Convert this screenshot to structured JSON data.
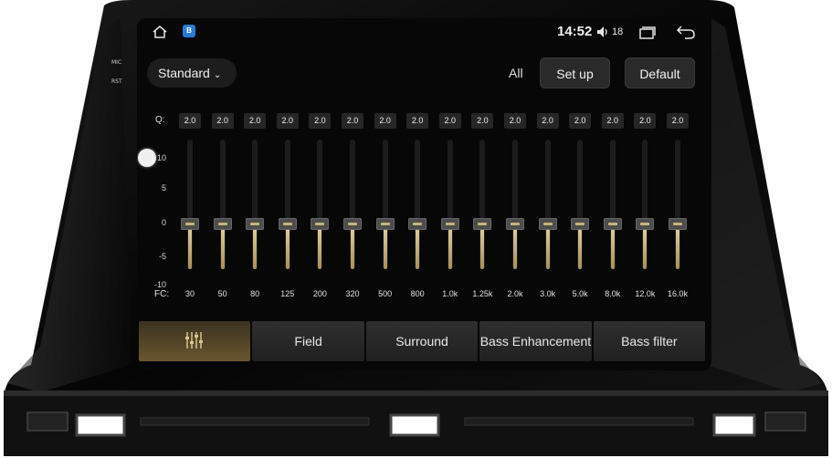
{
  "hardware": {
    "mic_label": "MIC",
    "rst_label": "RST"
  },
  "statusbar": {
    "clock": "14:52",
    "volume": "18",
    "icons": [
      "home-icon",
      "app-icon",
      "volume-icon",
      "recent-apps-icon",
      "back-icon"
    ]
  },
  "toolbar": {
    "preset": "Standard",
    "all_label": "All",
    "setup_label": "Set up",
    "default_label": "Default"
  },
  "eq": {
    "q_label": "Q:",
    "fc_label": "FC:",
    "y_ticks": [
      "10",
      "5",
      "0",
      "-5",
      "-10"
    ],
    "bands": [
      {
        "q": "2.0",
        "fc": "30",
        "gain": 0
      },
      {
        "q": "2.0",
        "fc": "50",
        "gain": 0
      },
      {
        "q": "2.0",
        "fc": "80",
        "gain": 0
      },
      {
        "q": "2.0",
        "fc": "125",
        "gain": 0
      },
      {
        "q": "2.0",
        "fc": "200",
        "gain": 0
      },
      {
        "q": "2.0",
        "fc": "320",
        "gain": 0
      },
      {
        "q": "2.0",
        "fc": "500",
        "gain": 0
      },
      {
        "q": "2.0",
        "fc": "800",
        "gain": 0
      },
      {
        "q": "2.0",
        "fc": "1.0k",
        "gain": 0
      },
      {
        "q": "2.0",
        "fc": "1.25k",
        "gain": 0
      },
      {
        "q": "2.0",
        "fc": "2.0k",
        "gain": 0
      },
      {
        "q": "2.0",
        "fc": "3.0k",
        "gain": 0
      },
      {
        "q": "2.0",
        "fc": "5.0k",
        "gain": 0
      },
      {
        "q": "2.0",
        "fc": "8.0k",
        "gain": 0
      },
      {
        "q": "2.0",
        "fc": "12.0k",
        "gain": 0
      },
      {
        "q": "2.0",
        "fc": "16.0k",
        "gain": 0
      }
    ]
  },
  "tabs": [
    {
      "label": "",
      "icon": "equalizer-icon",
      "active": true
    },
    {
      "label": "Field",
      "active": false
    },
    {
      "label": "Surround",
      "active": false
    },
    {
      "label": "Bass Enhancement",
      "active": false
    },
    {
      "label": "Bass filter",
      "active": false
    }
  ],
  "colors": {
    "accent": "#c9b37a",
    "screen_bg": "#070707",
    "bezel": "#0b0b0b"
  }
}
